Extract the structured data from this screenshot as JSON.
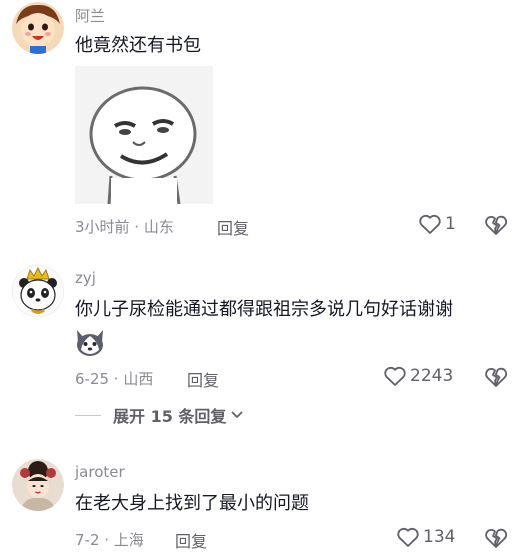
{
  "comments": [
    {
      "username": "阿兰",
      "text": "他竟然还有书包",
      "meta": "3小时前 · 山东",
      "reply_label": "回复",
      "likes": "1",
      "avatar_icon": "cartoon-boy-avatar",
      "sticker_icon": "meme-face-sticker"
    },
    {
      "username": "zyj",
      "text": "你儿子尿检能通过都得跟祖宗多说几句好话谢谢",
      "meta": "6-25 · 山西",
      "reply_label": "回复",
      "likes": "2243",
      "avatar_icon": "panda-king-avatar",
      "emoji_icon": "husky-emoji"
    },
    {
      "username": "jaroter",
      "text": "在老大身上找到了最小的问题",
      "meta": "7-2 · 上海",
      "reply_label": "回复",
      "likes": "134",
      "avatar_icon": "opera-girl-avatar"
    }
  ],
  "expand_replies": "展开 15 条回复",
  "colors": {
    "secondary": "#8a8b91",
    "primary_text": "#161823",
    "action": "#606168"
  }
}
